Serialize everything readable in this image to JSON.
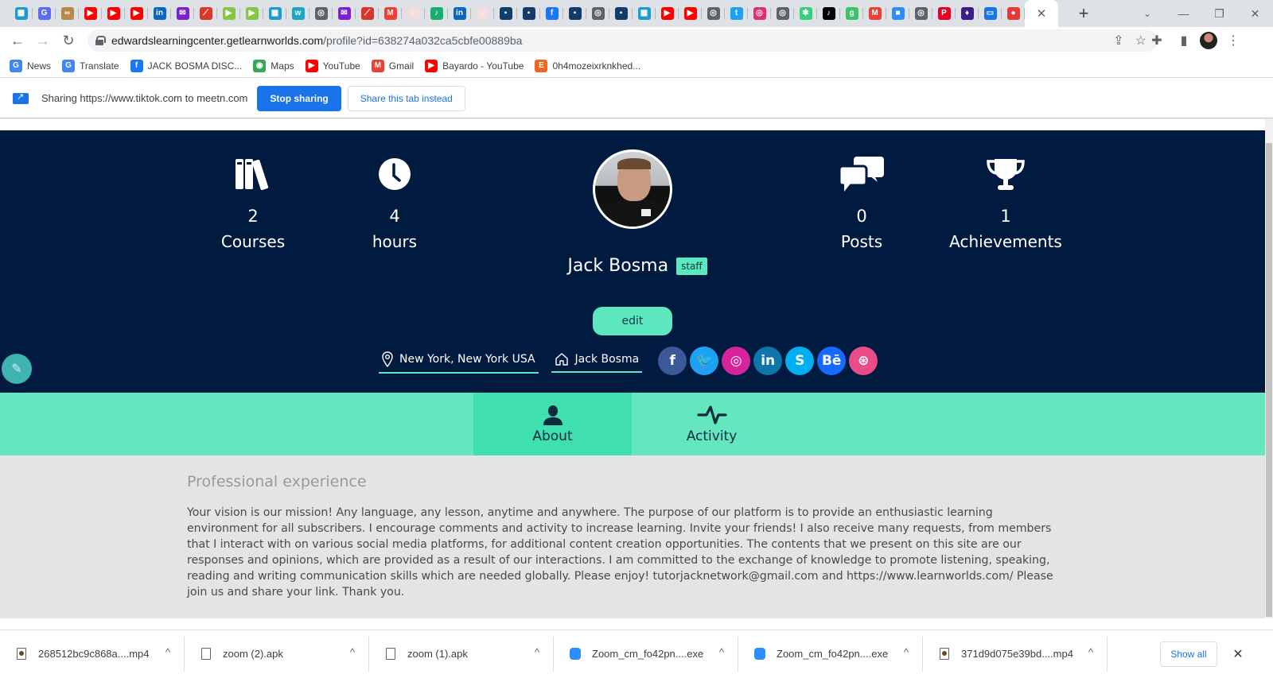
{
  "browser": {
    "tab_favicons": [
      {
        "name": "zoom-tab",
        "glyph": "▦",
        "bg": "#1d9bd1"
      },
      {
        "name": "google-tab",
        "glyph": "G",
        "bg": "#5a6cf0"
      },
      {
        "name": "link-tab",
        "glyph": "∞",
        "bg": "#b48a44"
      },
      {
        "name": "youtube-tab",
        "glyph": "▶",
        "bg": "#ff0000"
      },
      {
        "name": "youtube-tab",
        "glyph": "▶",
        "bg": "#ff0000"
      },
      {
        "name": "youtube-tab",
        "glyph": "▶",
        "bg": "#ff0000"
      },
      {
        "name": "linkedin-tab",
        "glyph": "in",
        "bg": "#0a66c2"
      },
      {
        "name": "mail-tab",
        "glyph": "✉",
        "bg": "#7b1fd1"
      },
      {
        "name": "slash-tab",
        "glyph": "⟋",
        "bg": "#d9372b"
      },
      {
        "name": "rumble-tab",
        "glyph": "▶",
        "bg": "#85c742"
      },
      {
        "name": "rumble-tab",
        "glyph": "▶",
        "bg": "#85c742"
      },
      {
        "name": "zoom-tab",
        "glyph": "▦",
        "bg": "#1d9bd1"
      },
      {
        "name": "w-tab",
        "glyph": "w",
        "bg": "#1aa6c7"
      },
      {
        "name": "chrome-tab",
        "glyph": "◎",
        "bg": "#5f6368"
      },
      {
        "name": "mail-tab",
        "glyph": "✉",
        "bg": "#7b1fd1"
      },
      {
        "name": "slash-tab",
        "glyph": "⟋",
        "bg": "#d9372b"
      },
      {
        "name": "gmail-tab",
        "glyph": "M",
        "bg": "#ea4335"
      },
      {
        "name": "blank-tab",
        "glyph": "○",
        "bg": "#f2dede"
      },
      {
        "name": "jb-tab",
        "glyph": "♪",
        "bg": "#1aae6c"
      },
      {
        "name": "linkedin-tab",
        "glyph": "in",
        "bg": "#0a66c2"
      },
      {
        "name": "blank-tab",
        "glyph": "○",
        "bg": "#f2dede"
      },
      {
        "name": "learnworlds-tab",
        "glyph": "▪",
        "bg": "#123d6b"
      },
      {
        "name": "learnworlds-tab",
        "glyph": "▪",
        "bg": "#123d6b"
      },
      {
        "name": "facebook-tab",
        "glyph": "f",
        "bg": "#1877f2"
      },
      {
        "name": "learnworlds-tab",
        "glyph": "▪",
        "bg": "#123d6b"
      },
      {
        "name": "chrome-tab",
        "glyph": "◎",
        "bg": "#5f6368"
      },
      {
        "name": "learnworlds-tab",
        "glyph": "▪",
        "bg": "#123d6b"
      },
      {
        "name": "zoom-tab",
        "glyph": "▦",
        "bg": "#1d9bd1"
      },
      {
        "name": "youtube-tab",
        "glyph": "▶",
        "bg": "#ff0000"
      },
      {
        "name": "youtube-tab",
        "glyph": "▶",
        "bg": "#ff0000"
      },
      {
        "name": "chrome-tab",
        "glyph": "◎",
        "bg": "#5f6368"
      },
      {
        "name": "twitter-tab",
        "glyph": "t",
        "bg": "#1da1f2"
      },
      {
        "name": "instagram-tab",
        "glyph": "◎",
        "bg": "#e1306c"
      },
      {
        "name": "chrome-tab",
        "glyph": "◎",
        "bg": "#5f6368"
      },
      {
        "name": "star-tab",
        "glyph": "✱",
        "bg": "#35d07f"
      },
      {
        "name": "tiktok-tab",
        "glyph": "♪",
        "bg": "#000000"
      },
      {
        "name": "g-tab",
        "glyph": "g",
        "bg": "#3ac569"
      },
      {
        "name": "gmail-tab",
        "glyph": "M",
        "bg": "#ea4335"
      },
      {
        "name": "zoom-tab",
        "glyph": "■",
        "bg": "#2d8cff"
      },
      {
        "name": "chrome-tab",
        "glyph": "◎",
        "bg": "#5f6368"
      },
      {
        "name": "pinterest-tab",
        "glyph": "P",
        "bg": "#e60023"
      },
      {
        "name": "app-tab",
        "glyph": "♦",
        "bg": "#3b1d8a"
      },
      {
        "name": "screen-tab",
        "glyph": "▭",
        "bg": "#1a73e8"
      },
      {
        "name": "record-tab",
        "glyph": "●",
        "bg": "#e53935"
      }
    ],
    "active_tab_close": "✕",
    "new_tab": "+",
    "tab_search": "⌄",
    "window_controls": {
      "minimize": "—",
      "maximize": "❐",
      "close": "✕"
    },
    "nav": {
      "back": "←",
      "forward": "→",
      "reload": "↻"
    },
    "url_host": "edwardslearningcenter.getlearnworlds.com",
    "url_path": "/profile?id=638274a032ca5cbfe00889ba",
    "omnibox_icons": {
      "share": "⇪",
      "bookmark": "☆"
    },
    "toolbar_icons": {
      "extensions": "✚",
      "side_panel": "▮",
      "menu": "⋮"
    },
    "bookmarks": [
      {
        "label": "News",
        "glyph": "G",
        "bg": "#4285f4"
      },
      {
        "label": "Translate",
        "glyph": "G",
        "bg": "#4285f4"
      },
      {
        "label": "JACK BOSMA DISC...",
        "glyph": "f",
        "bg": "#1877f2"
      },
      {
        "label": "Maps",
        "glyph": "◉",
        "bg": "#34a853"
      },
      {
        "label": "YouTube",
        "glyph": "▶",
        "bg": "#ff0000"
      },
      {
        "label": "Gmail",
        "glyph": "M",
        "bg": "#ea4335"
      },
      {
        "label": "Bayardo - YouTube",
        "glyph": "▶",
        "bg": "#ff0000"
      },
      {
        "label": "0h4mozeixrknkhed...",
        "glyph": "E",
        "bg": "#f16521"
      }
    ]
  },
  "infobar": {
    "text": "Sharing https://www.tiktok.com to meetn.com",
    "stop_label": "Stop sharing",
    "share_tab_label": "Share this tab instead"
  },
  "profile": {
    "stats": [
      {
        "value": "2",
        "label": "Courses",
        "icon": "books-icon"
      },
      {
        "value": "4",
        "label": "hours",
        "icon": "clock-icon"
      },
      {
        "value": "0",
        "label": "Posts",
        "icon": "comments-icon"
      },
      {
        "value": "1",
        "label": "Achievements",
        "icon": "trophy-icon"
      }
    ],
    "name": "Jack Bosma",
    "badge": "staff",
    "edit_label": "edit",
    "location": "New York, New York USA",
    "website": "Jack Bosma",
    "socials": [
      {
        "name": "facebook",
        "glyph": "f",
        "color": "#3b5998"
      },
      {
        "name": "twitter",
        "glyph": "🐦",
        "color": "#1da1f2"
      },
      {
        "name": "instagram",
        "glyph": "◎",
        "color": "#d6249f"
      },
      {
        "name": "linkedin",
        "glyph": "in",
        "color": "#0e76a8"
      },
      {
        "name": "skype",
        "glyph": "S",
        "color": "#00aff0"
      },
      {
        "name": "behance",
        "glyph": "Bē",
        "color": "#1769ff"
      },
      {
        "name": "dribbble",
        "glyph": "⊛",
        "color": "#ea4c89"
      }
    ],
    "tabs": [
      {
        "label": "About",
        "active": true
      },
      {
        "label": "Activity",
        "active": false
      }
    ],
    "about_heading": "Professional experience",
    "about_text": "Your vision is our mission! Any language, any lesson, anytime and anywhere. The purpose of our platform is to provide an enthusiastic learning environment for all subscribers. I encourage comments and activity to increase learning. Invite your friends! I also receive many requests, from members that I interact with on various social media platforms, for additional content creation opportunities. The contents that we present on this site are our responses and opinions, which are provided as a result of our interactions. I am committed to the exchange of knowledge to promote listening, speaking, reading and writing communication skills which are needed globally. Please enjoy! tutorjacknetwork@gmail.com and https://www.learnworlds.com/ Please join us and share your link. Thank you."
  },
  "colors": {
    "hero_bg": "#001a40",
    "accent": "#5ee8bf",
    "tab_active": "#3fdfae",
    "about_bg": "#e4e4e4"
  },
  "downloads": {
    "items": [
      {
        "name": "268512bc9c868a....mp4",
        "type": "video"
      },
      {
        "name": "zoom (2).apk",
        "type": "file"
      },
      {
        "name": "zoom (1).apk",
        "type": "file"
      },
      {
        "name": "Zoom_cm_fo42pn....exe",
        "type": "zoom"
      },
      {
        "name": "Zoom_cm_fo42pn....exe",
        "type": "zoom"
      },
      {
        "name": "371d9d075e39bd....mp4",
        "type": "video"
      }
    ],
    "show_all": "Show all",
    "close": "✕",
    "chevron": "^"
  }
}
